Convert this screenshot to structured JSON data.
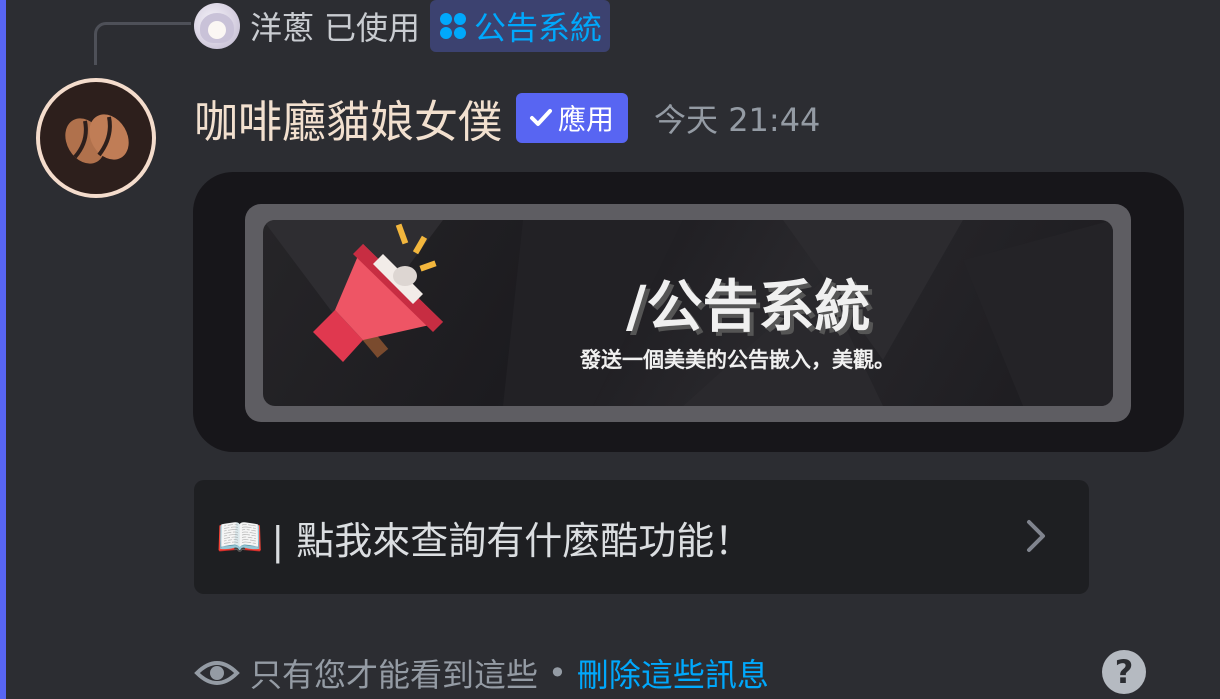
{
  "reply": {
    "username": "洋蔥",
    "used_text": "已使用",
    "command": "公告系統"
  },
  "message": {
    "bot_name": "咖啡廳貓娘女僕",
    "app_badge": "應用",
    "timestamp": "今天 21:44"
  },
  "banner": {
    "title": "/公告系統",
    "subtitle": "發送一個美美的公告嵌入，美觀。"
  },
  "action_button": {
    "emoji": "📖",
    "label": "| 點我來查詢有什麼酷功能！"
  },
  "footer": {
    "notice": "只有您才能看到這些",
    "separator": "•",
    "dismiss_link": "刪除這些訊息"
  },
  "help": {
    "label": "?"
  },
  "colors": {
    "accent": "#5865f2",
    "link": "#00a8fc",
    "bot_name": "#f2e0cf"
  }
}
